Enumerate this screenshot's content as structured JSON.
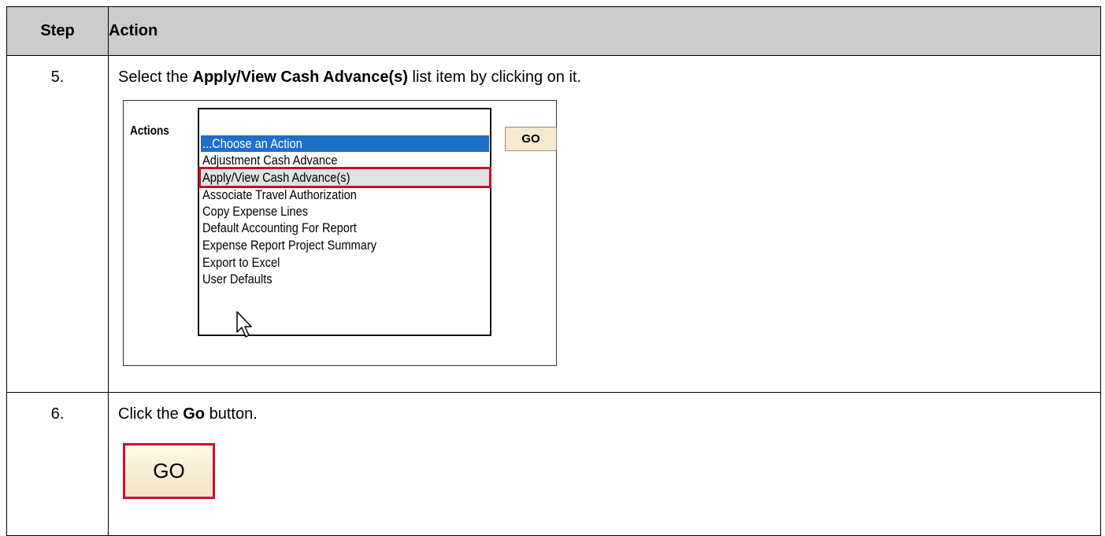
{
  "header": {
    "step": "Step",
    "action": "Action"
  },
  "rows": [
    {
      "step": "5.",
      "text_before": "Select the ",
      "text_bold": "Apply/View Cash Advance(s)",
      "text_after": " list item by clicking on it."
    },
    {
      "step": "6.",
      "text_before": "Click the ",
      "text_bold": "Go",
      "text_after": " button."
    }
  ],
  "shot1": {
    "actions_label": "Actions",
    "go_label": "GO",
    "items": [
      "...Choose an Action",
      "Adjustment Cash Advance",
      "Apply/View Cash Advance(s)",
      "Associate Travel Authorization",
      "Copy Expense Lines",
      "Default Accounting For Report",
      "Expense Report Project Summary",
      "Export to Excel",
      "User Defaults"
    ],
    "selected_index": 0,
    "highlighted_index": 2,
    "selected_color": "#1e6fc8",
    "highlight_border_color": "#c8102e"
  },
  "shot2": {
    "go_label": "GO",
    "border_color": "#c8102e"
  }
}
